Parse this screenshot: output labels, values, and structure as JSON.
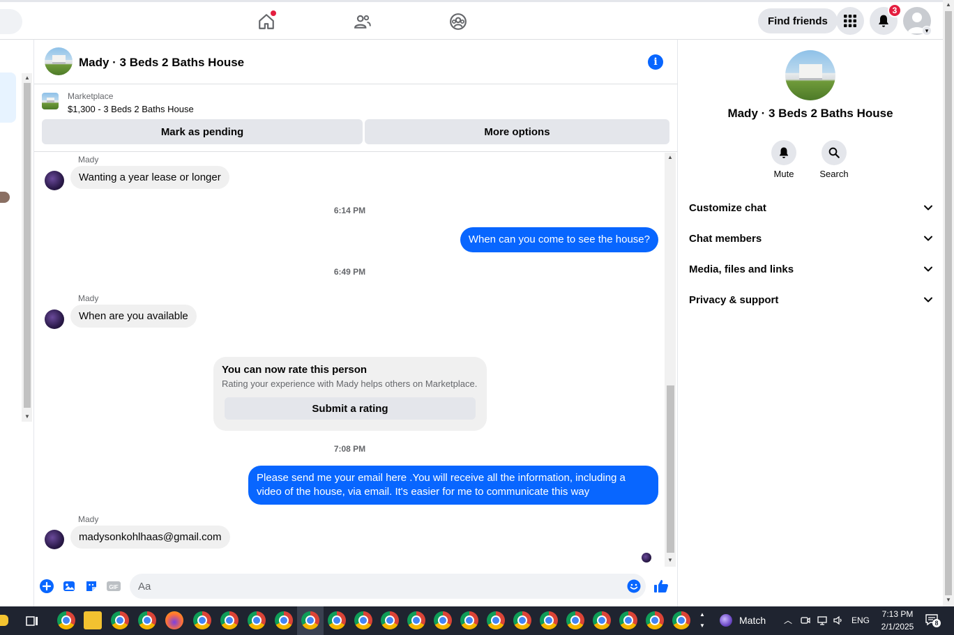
{
  "nav": {
    "find_friends": "Find friends",
    "notification_count": "3"
  },
  "chat": {
    "title": "Mady · 3 Beds 2 Baths House",
    "marketplace_label": "Marketplace",
    "listing": "$1,300 - 3 Beds 2 Baths House",
    "mark_pending": "Mark as pending",
    "more_options": "More options",
    "messages": [
      {
        "sender": "Mady",
        "text": "Wanting a year lease or longer"
      },
      {
        "time": "6:14 PM"
      },
      {
        "text": "When can you come to see the house?"
      },
      {
        "time": "6:49 PM"
      },
      {
        "sender": "Mady",
        "text": "When are you available"
      },
      {
        "time": "7:08 PM"
      },
      {
        "text": "Please send me your email here .You will receive all the information, including a video of the house, via email. It's easier for me to communicate this way"
      },
      {
        "sender": "Mady",
        "text": "madysonkohlhaas@gmail.com"
      }
    ],
    "rating": {
      "title": "You can now rate this person",
      "subtitle": "Rating your experience with Mady helps others on Marketplace.",
      "button": "Submit a rating"
    },
    "composer_placeholder": "Aa"
  },
  "details": {
    "title": "Mady · 3 Beds 2 Baths House",
    "mute": "Mute",
    "search": "Search",
    "sections": [
      "Customize chat",
      "Chat members",
      "Media, files and links",
      "Privacy & support"
    ]
  },
  "taskbar": {
    "weather": "Match",
    "language": "ENG",
    "time": "7:13 PM",
    "date": "2/1/2025",
    "notif_count": "8"
  },
  "colors": {
    "accent": "#0866ff",
    "badge": "#e41e3f",
    "bubble_in": "#f0f0f0"
  }
}
